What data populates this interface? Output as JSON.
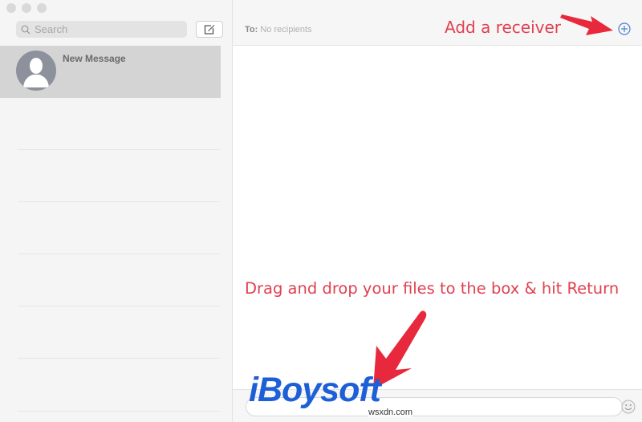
{
  "window": {
    "traffic_lights": [
      "close",
      "minimize",
      "zoom"
    ]
  },
  "sidebar": {
    "search": {
      "placeholder": "Search",
      "value": ""
    },
    "compose_icon": "compose-icon",
    "conversations": [
      {
        "name": "New Message",
        "avatar": "person-silhouette",
        "selected": true
      }
    ]
  },
  "header": {
    "to_label": "To:",
    "recipients_placeholder": "No recipients",
    "add_icon": "plus-circle-icon"
  },
  "annotations": {
    "add_receiver": "Add a receiver",
    "drag_drop": "Drag and drop your files to the box & hit Return"
  },
  "footer": {
    "message_value": "",
    "emoji_icon": "emoji-icon"
  },
  "branding": {
    "logo": "iBoysoft",
    "watermark": "wsxdn.com"
  },
  "colors": {
    "annotation": "#e0414f",
    "arrow": "#e8283c",
    "logo": "#1c5fd6",
    "add_icon": "#4a7fd6"
  }
}
